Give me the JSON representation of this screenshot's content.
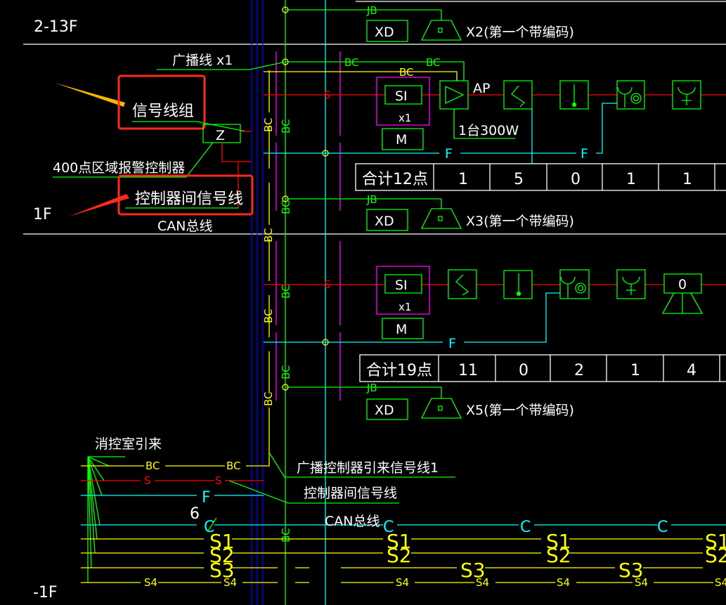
{
  "colors": {
    "background": "#000000",
    "signal_bus": "#00ff00",
    "broadcast": "#ffff00",
    "s_line": "#ff0000",
    "f_line": "#00ffff",
    "riser": "#0000ff",
    "zone_box": "#ff00ff",
    "highlight": "#ff2a1a",
    "arrow_yellow": "#ffb400"
  },
  "floors": {
    "upper": "2-13F",
    "ground": "1F",
    "basement": "-1F"
  },
  "annotations": {
    "broadcast_line": "广播线  x1",
    "signal_group": "信号线组",
    "controller_box": "Z",
    "zone_controller": "400点区域报警控制器",
    "inter_controller": "控制器间信号线",
    "can_bus": "CAN总线",
    "from_control_room": "消控室引来",
    "broadcast_signal": "广播控制器引来信号线1",
    "inter_controller_2": "控制器间信号线",
    "can_bus_2": "CAN总线",
    "count_6": "6"
  },
  "wire_labels": {
    "bc": "BC",
    "jb": "JB",
    "s": "S",
    "f": "F",
    "c": "C",
    "s1": "S1",
    "s2": "S2",
    "s3": "S3",
    "s4": "S4"
  },
  "devices": {
    "si": "SI",
    "x1": "x1",
    "m": "M",
    "ap": "AP",
    "amp_power": "1台300W",
    "xd": "XD",
    "zero": "0"
  },
  "speakers": [
    "X2(第一个带编码)",
    "X3(第一个带编码)",
    "X5(第一个带编码)"
  ],
  "tables": [
    {
      "label": "合计12点",
      "values": [
        "1",
        "5",
        "0",
        "1",
        "1"
      ]
    },
    {
      "label": "合计19点",
      "values": [
        "11",
        "0",
        "2",
        "1",
        "4"
      ]
    }
  ],
  "icons": [
    "amplifier-icon",
    "input-module-icon",
    "smoke-detector-icon",
    "heat-smoke-detector-icon",
    "manual-alarm-icon",
    "alarm-bell-icon",
    "speaker-icon"
  ]
}
